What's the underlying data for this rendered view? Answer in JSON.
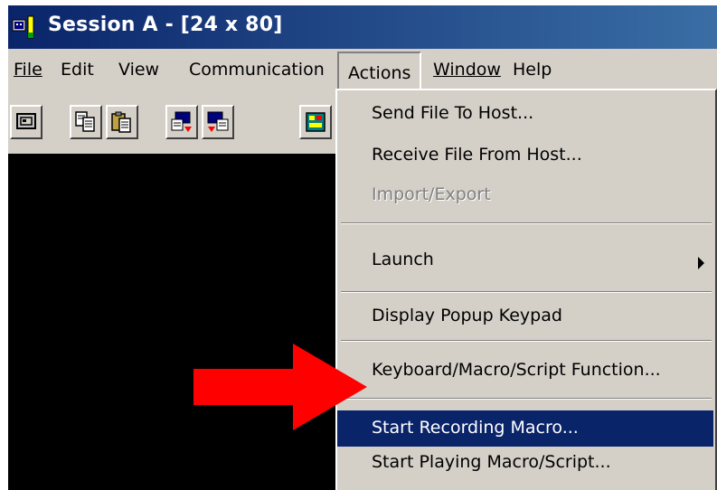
{
  "window": {
    "title": "Session A - [24 x 80]"
  },
  "menubar": {
    "file": "File",
    "edit": "Edit",
    "view": "View",
    "communication": "Communication",
    "actions": "Actions",
    "window": "Window",
    "help": "Help"
  },
  "actions_menu": {
    "send_file": "Send File To Host...",
    "receive_file": "Receive File From Host...",
    "import_export": "Import/Export",
    "launch": "Launch",
    "display_keypad": "Display Popup Keypad",
    "keyboard_macro": "Keyboard/Macro/Script Function...",
    "start_recording": "Start Recording Macro...",
    "start_playing": "Start Playing Macro/Script..."
  },
  "colors": {
    "title_bar": "#0a246a",
    "selection": "#0a246a",
    "terminal_bg": "#000000",
    "arrow": "#ff0000"
  },
  "icons": {
    "app": "session-app-icon",
    "toolbar": [
      "screen-icon",
      "copy-icon",
      "paste-icon",
      "send-file-icon",
      "receive-file-icon",
      "keypad-icon"
    ],
    "submenu": "submenu-arrow-icon",
    "pointer": "red-pointer-arrow"
  }
}
